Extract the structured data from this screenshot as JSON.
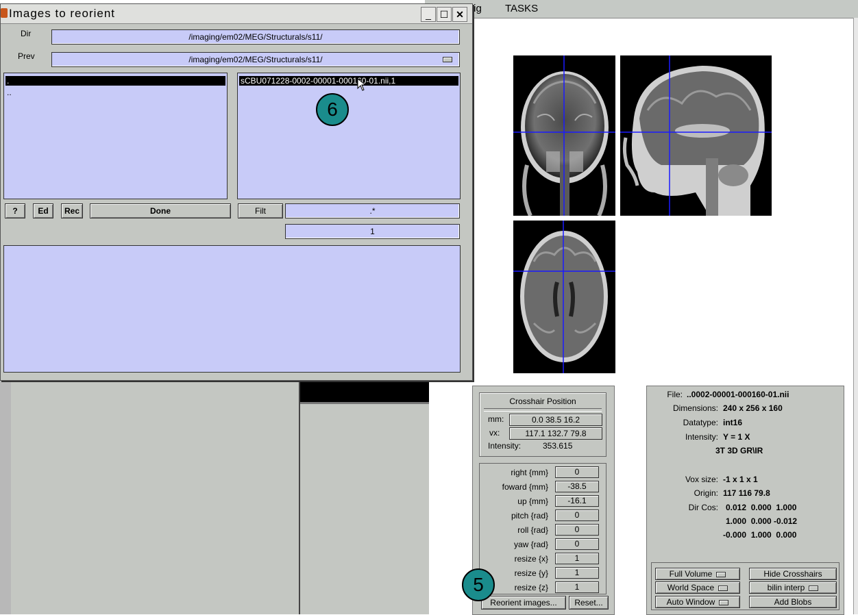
{
  "graphics_menu": {
    "item_fig": "-Fig",
    "item_tasks": "TASKS"
  },
  "dialog": {
    "title": "Images to reorient",
    "dir_label": "Dir",
    "dir_value": "/imaging/em02/MEG/Structurals/s11/",
    "prev_label": "Prev",
    "prev_value": "/imaging/em02/MEG/Structurals/s11/",
    "dir_list": {
      "selected": ".",
      "items": [
        ".."
      ]
    },
    "file_list": {
      "selected": "sCBU071228-0002-00001-000160-01.nii,1"
    },
    "buttons": {
      "help": "?",
      "ed": "Ed",
      "rec": "Rec",
      "done": "Done",
      "filt": "Filt"
    },
    "filter_value": ".*",
    "frames_value": "1"
  },
  "crosshair": {
    "title": "Crosshair Position",
    "mm_label": "mm:",
    "mm_value": "0.0 38.5 16.2",
    "vx_label": "vx:",
    "vx_value": "117.1 132.7 79.8",
    "intensity_label": "Intensity:",
    "intensity_value": "353.615"
  },
  "reorient_params": [
    {
      "label": "right  {mm}",
      "value": "0"
    },
    {
      "label": "foward  {mm}",
      "value": "-38.5"
    },
    {
      "label": "up  {mm}",
      "value": "-16.1"
    },
    {
      "label": "pitch  {rad}",
      "value": "0"
    },
    {
      "label": "roll  {rad}",
      "value": "0"
    },
    {
      "label": "yaw  {rad}",
      "value": "0"
    },
    {
      "label": "resize  {x}",
      "value": "1"
    },
    {
      "label": "resize  {y}",
      "value": "1"
    },
    {
      "label": "resize  {z}",
      "value": "1"
    }
  ],
  "reorient_buttons": {
    "reorient": "Reorient images...",
    "reset": "Reset..."
  },
  "info": {
    "file_label": "File:",
    "file_value": "..0002-00001-000160-01.nii",
    "dims_label": "Dimensions:",
    "dims_value": "240 x 256 x 160",
    "dtype_label": "Datatype:",
    "dtype_value": "int16",
    "intensity_label": "Intensity:",
    "intensity_value": "Y = 1 X",
    "descrip_value": "3T 3D GR\\IR",
    "voxsize_label": "Vox size:",
    "voxsize_value": "-1 x 1 x 1",
    "origin_label": "Origin:",
    "origin_value": "117 116 79.8",
    "dircos_label": "Dir Cos:",
    "dircos_rows": [
      "0.012  0.000  1.000",
      "1.000  0.000 -0.012",
      "-0.000  1.000  0.000"
    ]
  },
  "display_buttons": {
    "full_volume": "Full Volume",
    "hide_crosshairs": "Hide Crosshairs",
    "world_space": "World Space",
    "bilin_interp": "bilin interp",
    "auto_window": "Auto Window",
    "add_blobs": "Add Blobs"
  },
  "callouts": {
    "five": "5",
    "six": "6"
  },
  "colors": {
    "list_bg": "#c8cbf8",
    "panel_bg": "#c4c7c2",
    "crosshair": "#1a1aff",
    "callout": "#1a8c8c"
  }
}
